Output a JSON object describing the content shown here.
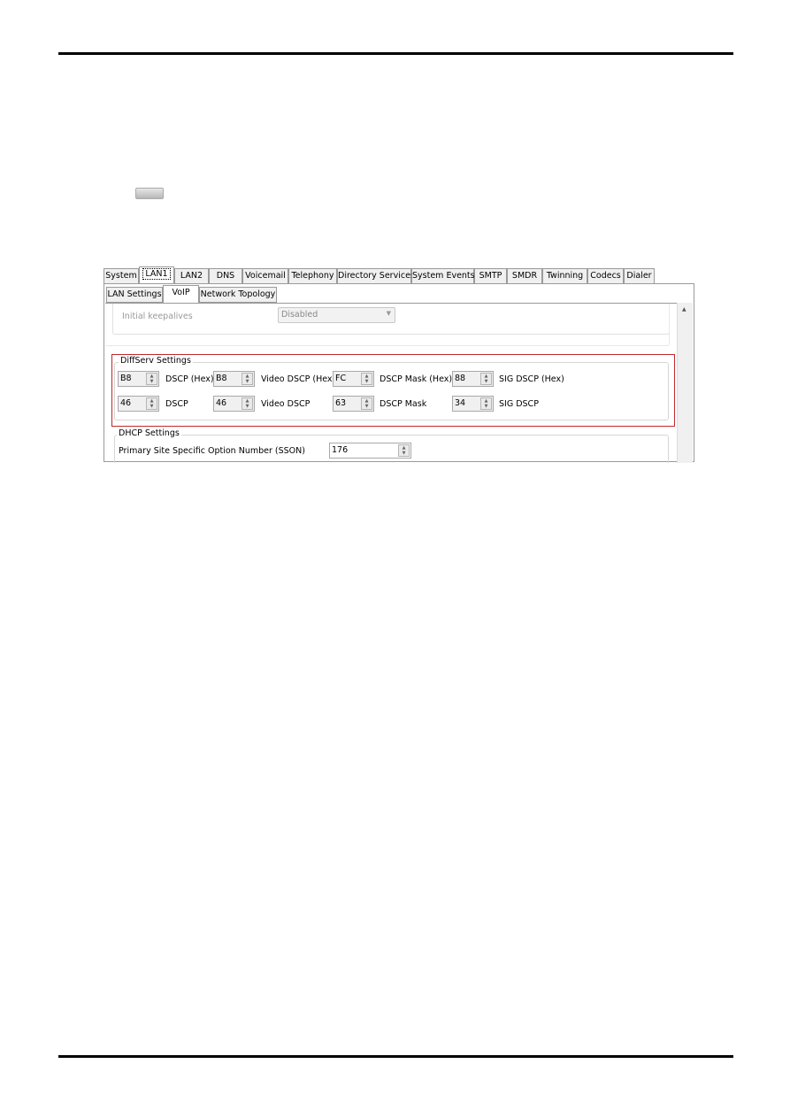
{
  "tabs": [
    "System",
    "LAN1",
    "LAN2",
    "DNS",
    "Voicemail",
    "Telephony",
    "Directory Services",
    "System Events",
    "SMTP",
    "SMDR",
    "Twinning",
    "Codecs",
    "Dialer"
  ],
  "active_tab": "LAN1",
  "subtabs": [
    "LAN Settings",
    "VoIP",
    "Network Topology"
  ],
  "active_subtab": "VoIP",
  "keepalives": {
    "label": "Initial keepalives",
    "value": "Disabled"
  },
  "diffserv": {
    "title": "DiffServ Settings",
    "row1": [
      {
        "value": "B8",
        "label": "DSCP (Hex)"
      },
      {
        "value": "B8",
        "label": "Video DSCP (Hex)"
      },
      {
        "value": "FC",
        "label": "DSCP Mask (Hex)"
      },
      {
        "value": "88",
        "label": "SIG DSCP (Hex)"
      }
    ],
    "row2": [
      {
        "value": "46",
        "label": "DSCP"
      },
      {
        "value": "46",
        "label": "Video DSCP"
      },
      {
        "value": "63",
        "label": "DSCP Mask"
      },
      {
        "value": "34",
        "label": "SIG DSCP"
      }
    ]
  },
  "dhcp": {
    "title": "DHCP Settings",
    "sson_label": "Primary Site Specific Option Number (SSON)",
    "sson_value": "176"
  },
  "colors": {
    "highlight": "#c0282d"
  }
}
